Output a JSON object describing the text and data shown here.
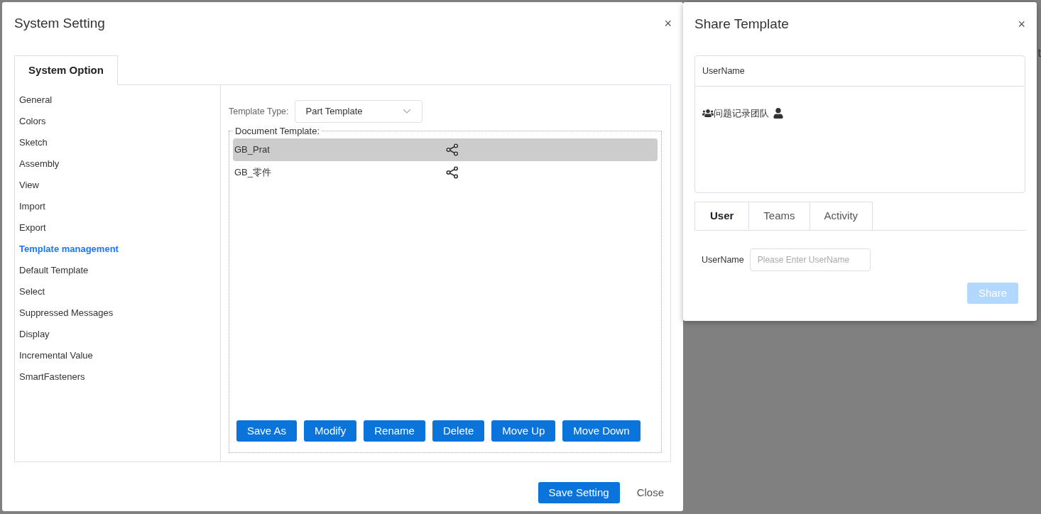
{
  "background_text": "t",
  "system_setting": {
    "title": "System Setting",
    "close_glyph": "×",
    "tabs": [
      {
        "label": "System Option",
        "selected": true
      }
    ],
    "sidebar": {
      "items": [
        {
          "label": "General",
          "selected": false
        },
        {
          "label": "Colors",
          "selected": false
        },
        {
          "label": "Sketch",
          "selected": false
        },
        {
          "label": "Assembly",
          "selected": false
        },
        {
          "label": "View",
          "selected": false
        },
        {
          "label": "Import",
          "selected": false
        },
        {
          "label": "Export",
          "selected": false
        },
        {
          "label": "Template management",
          "selected": true
        },
        {
          "label": "Default Template",
          "selected": false
        },
        {
          "label": "Select",
          "selected": false
        },
        {
          "label": "Suppressed Messages",
          "selected": false
        },
        {
          "label": "Display",
          "selected": false
        },
        {
          "label": "Incremental Value",
          "selected": false
        },
        {
          "label": "SmartFasteners",
          "selected": false
        }
      ]
    },
    "template_type": {
      "label": "Template Type:",
      "value": "Part Template"
    },
    "document_template": {
      "legend": "Document Template:",
      "rows": [
        {
          "name": "GB_Prat",
          "selected": true
        },
        {
          "name": "GB_零件",
          "selected": false
        }
      ]
    },
    "actions": [
      "Save As",
      "Modify",
      "Rename",
      "Delete",
      "Move Up",
      "Move Down"
    ],
    "footer": {
      "primary": "Save Setting",
      "secondary": "Close"
    }
  },
  "share_template": {
    "title": "Share Template",
    "close_glyph": "×",
    "table": {
      "header": "UserName",
      "rows": [
        {
          "name": "问题记录团队"
        }
      ]
    },
    "tabs": [
      {
        "label": "User",
        "selected": true
      },
      {
        "label": "Teams",
        "selected": false
      },
      {
        "label": "Activity",
        "selected": false
      }
    ],
    "form": {
      "label": "UserName",
      "placeholder": "Please Enter UserName"
    },
    "share_button": {
      "label": "Share",
      "disabled": true
    }
  }
}
